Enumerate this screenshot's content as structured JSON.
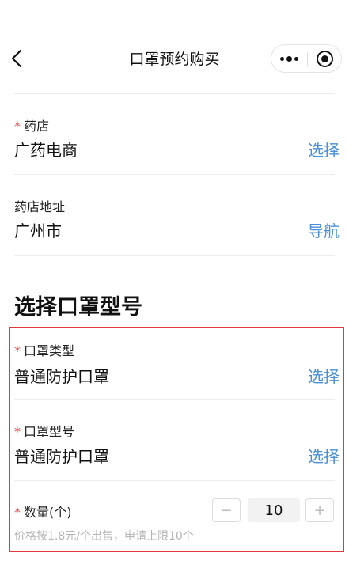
{
  "navbar": {
    "title": "口罩预约购买",
    "back_icon": "chevron-left-icon",
    "more_icon": "more-dots-icon",
    "home_icon": "target-icon"
  },
  "pharmacy": {
    "label": "药店",
    "value": "广药电商",
    "action": "选择"
  },
  "address": {
    "label": "药店地址",
    "value": "广州市",
    "action": "导航"
  },
  "section": {
    "title": "选择口罩型号"
  },
  "mask_type": {
    "label": "口罩类型",
    "value": "普通防护口罩",
    "action": "选择"
  },
  "mask_model": {
    "label": "口罩型号",
    "value": "普通防护口罩",
    "action": "选择"
  },
  "quantity": {
    "label": "数量(个)",
    "minus": "−",
    "value": "10",
    "plus": "+",
    "hint": "价格按1.8元/个出售，申请上限10个"
  },
  "required_mark": "*",
  "colors": {
    "accent_blue": "#4a90d9",
    "required_red": "#e8474b",
    "highlight_border": "#e0393c"
  }
}
